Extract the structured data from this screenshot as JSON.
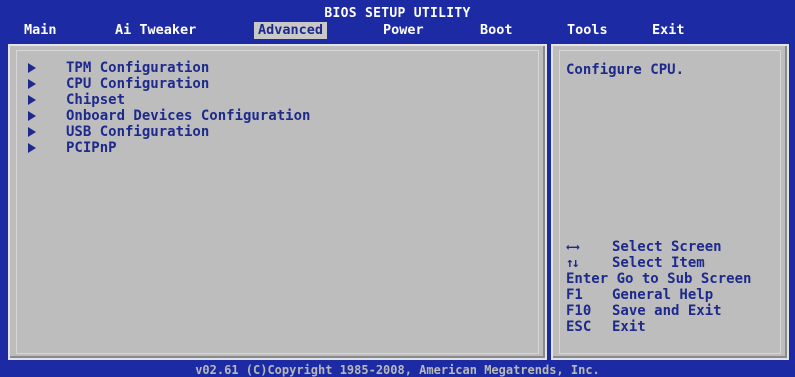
{
  "header": {
    "title": "BIOS SETUP UTILITY",
    "menu": [
      "Main",
      "Ai Tweaker",
      "Advanced",
      "Power",
      "Boot",
      "Tools",
      "Exit"
    ],
    "active_menu": "Advanced"
  },
  "main": {
    "items": [
      "TPM Configuration",
      "CPU Configuration",
      "Chipset",
      "Onboard Devices Configuration",
      "USB Configuration",
      "PCIPnP"
    ]
  },
  "help": {
    "text": "Configure CPU.",
    "keys": [
      {
        "key": "←→",
        "action": "Select Screen"
      },
      {
        "key": "↑↓",
        "action": "Select Item"
      },
      {
        "key": "Enter",
        "action": "Go to Sub Screen"
      },
      {
        "key": "F1",
        "action": "General Help"
      },
      {
        "key": "F10",
        "action": "Save and Exit"
      },
      {
        "key": "ESC",
        "action": "Exit"
      }
    ]
  },
  "footer": {
    "text": "v02.61 (C)Copyright 1985-2008, American Megatrends, Inc."
  },
  "colors": {
    "frame_blue": "#1c2aa3",
    "panel_gray": "#bdbdbd",
    "text_blue": "#1d2a8c"
  }
}
